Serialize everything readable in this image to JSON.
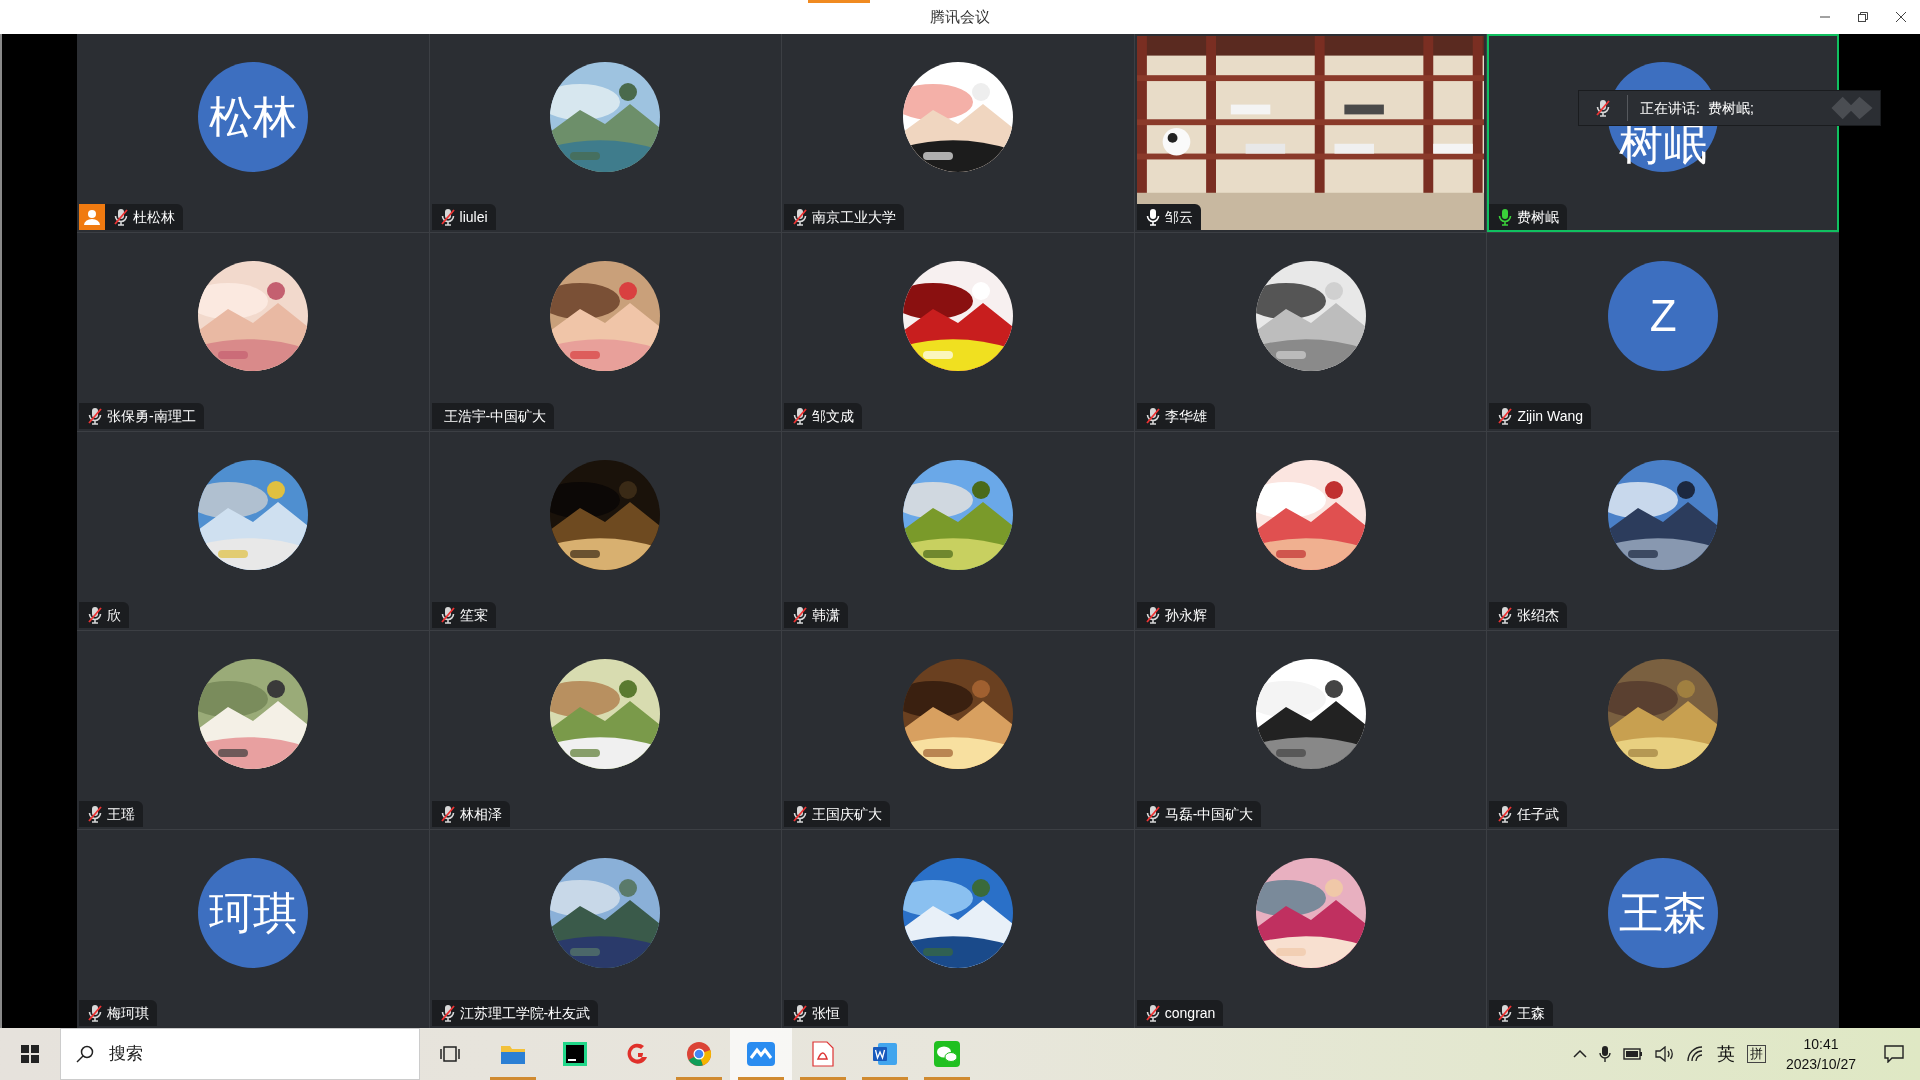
{
  "window": {
    "title": "腾讯会议"
  },
  "participants": [
    {
      "name": "杜松林",
      "avatar": {
        "kind": "initials",
        "text": "松林"
      },
      "mic_shown": true,
      "muted": true,
      "speaking": false,
      "host": true,
      "highlighted": false
    },
    {
      "name": "liulei",
      "mic_shown": true,
      "muted": true,
      "speaking": false,
      "host": false,
      "highlighted": false
    },
    {
      "name": "南京工业大学",
      "mic_shown": true,
      "muted": true,
      "speaking": false,
      "host": false,
      "highlighted": false
    },
    {
      "name": "邹云",
      "avatar": {
        "kind": "video"
      },
      "mic_shown": true,
      "muted": false,
      "speaking": false,
      "host": false,
      "highlighted": false
    },
    {
      "name": "费树岷",
      "avatar": {
        "kind": "initials",
        "text": "树岷"
      },
      "mic_shown": true,
      "muted": false,
      "speaking": true,
      "host": false,
      "highlighted": true
    },
    {
      "name": "张保勇-南理工",
      "mic_shown": true,
      "muted": true,
      "speaking": false,
      "host": false,
      "highlighted": false
    },
    {
      "name": "王浩宇-中国矿大",
      "mic_shown": false,
      "host": false,
      "highlighted": false
    },
    {
      "name": "邹文成",
      "mic_shown": true,
      "muted": true,
      "speaking": false,
      "host": false,
      "highlighted": false
    },
    {
      "name": "李华雄",
      "mic_shown": true,
      "muted": true,
      "speaking": false,
      "host": false,
      "highlighted": false
    },
    {
      "name": "Zijin Wang",
      "avatar": {
        "kind": "initials",
        "text": "Z"
      },
      "mic_shown": true,
      "muted": true,
      "speaking": false,
      "host": false,
      "highlighted": false
    },
    {
      "name": "欣",
      "mic_shown": true,
      "muted": true,
      "speaking": false,
      "host": false,
      "highlighted": false
    },
    {
      "name": "笙宷",
      "mic_shown": true,
      "muted": true,
      "speaking": false,
      "host": false,
      "highlighted": false
    },
    {
      "name": "韩潇",
      "mic_shown": true,
      "muted": true,
      "speaking": false,
      "host": false,
      "highlighted": false
    },
    {
      "name": "孙永辉",
      "mic_shown": true,
      "muted": true,
      "speaking": false,
      "host": false,
      "highlighted": false
    },
    {
      "name": "张绍杰",
      "mic_shown": true,
      "muted": true,
      "speaking": false,
      "host": false,
      "highlighted": false
    },
    {
      "name": "王瑶",
      "mic_shown": true,
      "muted": true,
      "speaking": false,
      "host": false,
      "highlighted": false
    },
    {
      "name": "林相泽",
      "mic_shown": true,
      "muted": true,
      "speaking": false,
      "host": false,
      "highlighted": false
    },
    {
      "name": "王国庆矿大",
      "mic_shown": true,
      "muted": true,
      "speaking": false,
      "host": false,
      "highlighted": false
    },
    {
      "name": "马磊-中国矿大",
      "mic_shown": true,
      "muted": true,
      "speaking": false,
      "host": false,
      "highlighted": false
    },
    {
      "name": "任子武",
      "mic_shown": true,
      "muted": true,
      "speaking": false,
      "host": false,
      "highlighted": false
    },
    {
      "name": "梅珂琪",
      "avatar": {
        "kind": "initials",
        "text": "珂琪"
      },
      "mic_shown": true,
      "muted": true,
      "speaking": false,
      "host": false,
      "highlighted": false
    },
    {
      "name": "江苏理工学院-杜友武",
      "mic_shown": true,
      "muted": true,
      "speaking": false,
      "host": false,
      "highlighted": false
    },
    {
      "name": "张恒",
      "mic_shown": true,
      "muted": true,
      "speaking": false,
      "host": false,
      "highlighted": false
    },
    {
      "name": "congran",
      "mic_shown": true,
      "muted": true,
      "speaking": false,
      "host": false,
      "highlighted": false
    },
    {
      "name": "王森",
      "avatar": {
        "kind": "initials",
        "text": "王森"
      },
      "mic_shown": true,
      "muted": true,
      "speaking": false,
      "host": false,
      "highlighted": false
    }
  ],
  "speaking_notice": {
    "label": "正在讲话:",
    "names": "费树岷;"
  },
  "taskbar": {
    "search": {
      "placeholder": "搜索"
    },
    "apps": [
      {
        "kind": "folder",
        "running": true,
        "selected": false
      },
      {
        "kind": "editor",
        "running": false,
        "selected": false
      },
      {
        "kind": "swirl",
        "running": false,
        "selected": false
      },
      {
        "kind": "browser",
        "running": true,
        "selected": false
      },
      {
        "kind": "meeting",
        "running": true,
        "selected": true
      },
      {
        "kind": "pdf",
        "running": true,
        "selected": false
      },
      {
        "kind": "document",
        "running": true,
        "selected": false
      },
      {
        "kind": "chat",
        "running": true,
        "selected": false
      }
    ],
    "tray": {
      "language": "英",
      "ime": "拼",
      "time": "10:41",
      "date": "2023/10/27"
    }
  }
}
